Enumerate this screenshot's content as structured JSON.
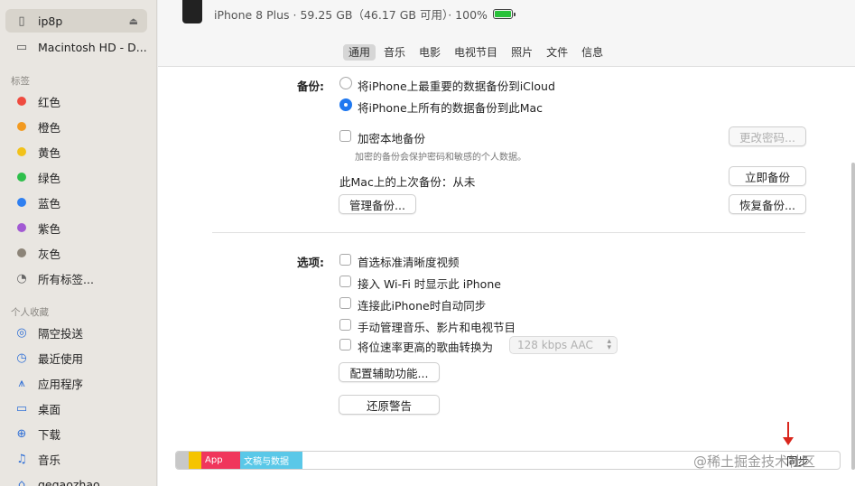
{
  "sidebar": {
    "locations": [
      {
        "label": "ip8p",
        "icon": "phone-icon",
        "selected": true
      },
      {
        "label": "Macintosh HD - D...",
        "icon": "disk-icon",
        "selected": false
      }
    ],
    "tags_heading": "标签",
    "tags": [
      {
        "label": "红色",
        "color": "#ef4b3f"
      },
      {
        "label": "橙色",
        "color": "#f29a20"
      },
      {
        "label": "黄色",
        "color": "#f2c21a"
      },
      {
        "label": "绿色",
        "color": "#2ebf4b"
      },
      {
        "label": "蓝色",
        "color": "#2f7ff0"
      },
      {
        "label": "紫色",
        "color": "#a25ad3"
      },
      {
        "label": "灰色",
        "color": "#8c8478"
      },
      {
        "label": "所有标签...",
        "color": ""
      }
    ],
    "favorites_heading": "个人收藏",
    "favorites": [
      {
        "label": "隔空投送",
        "icon": "airdrop-icon"
      },
      {
        "label": "最近使用",
        "icon": "clock-icon"
      },
      {
        "label": "应用程序",
        "icon": "apps-icon"
      },
      {
        "label": "桌面",
        "icon": "desktop-icon"
      },
      {
        "label": "下载",
        "icon": "download-icon"
      },
      {
        "label": "音乐",
        "icon": "music-icon"
      },
      {
        "label": "gegaozhao",
        "icon": "home-icon"
      }
    ]
  },
  "device": {
    "subtitle": "iPhone 8 Plus · 59.25 GB（46.17 GB 可用）· 100%"
  },
  "tabs": [
    "通用",
    "音乐",
    "电影",
    "电视节目",
    "照片",
    "文件",
    "信息"
  ],
  "active_tab": "通用",
  "backup": {
    "label": "备份:",
    "option_icloud": "将iPhone上最重要的数据备份到iCloud",
    "option_mac": "将iPhone上所有的数据备份到此Mac",
    "encrypt_label": "加密本地备份",
    "encrypt_hint": "加密的备份会保护密码和敏感的个人数据。",
    "change_password": "更改密码...",
    "last_backup": "此Mac上的上次备份：从未",
    "backup_now": "立即备份",
    "manage": "管理备份...",
    "restore": "恢复备份..."
  },
  "options": {
    "label": "选项:",
    "items": [
      "首选标准清晰度视频",
      "接入 Wi-Fi 时显示此 iPhone",
      "连接此iPhone时自动同步",
      "手动管理音乐、影片和电视节目",
      "将位速率更高的歌曲转换为"
    ],
    "bitrate": "128 kbps AAC",
    "accessibility": "配置辅助功能...",
    "reset_warnings": "还原警告"
  },
  "storage": {
    "segments": [
      {
        "label": "",
        "color": "#c8c8c8"
      },
      {
        "label": "",
        "color": "#f5c400"
      },
      {
        "label": "App",
        "color": "#f0365c"
      },
      {
        "label": "文稿与数据",
        "color": "#5ac8e8"
      }
    ]
  },
  "sync_label": "同步",
  "watermark": "@稀土掘金技术社区"
}
